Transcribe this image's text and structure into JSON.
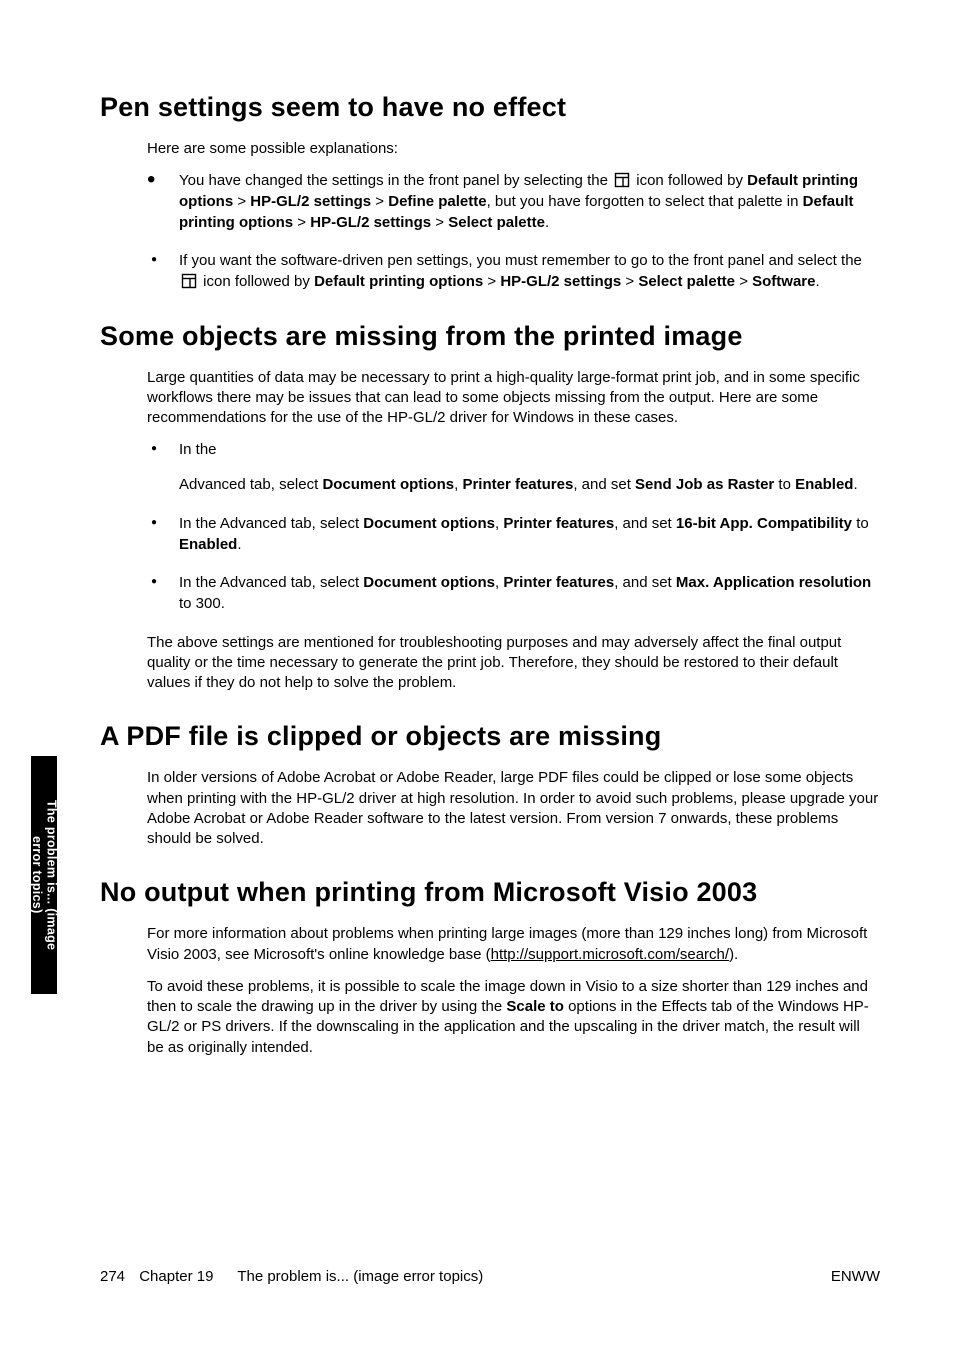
{
  "sections": {
    "pen": {
      "heading": "Pen settings seem to have no effect",
      "intro": "Here are some possible explanations:",
      "bullets": [
        {
          "pre": "You have changed the settings in the front panel by selecting the ",
          "post1": " icon followed by ",
          "b1": "Default printing options",
          "gt1": " > ",
          "b2": "HP-GL/2 settings",
          "gt2": " > ",
          "b3": "Define palette",
          "mid": ", but you have forgotten to select that palette in ",
          "b4": "Default printing options",
          "gt3": " > ",
          "b5": "HP-GL/2 settings",
          "gt4": " > ",
          "b6": "Select palette",
          "end": "."
        },
        {
          "pre": "If you want the software-driven pen settings, you must remember to go to the front panel and select the ",
          "post1": " icon followed by ",
          "b1": "Default printing options",
          "gt1": " > ",
          "b2": "HP-GL/2 settings",
          "gt2": " > ",
          "b3": "Select palette",
          "gt3": " > ",
          "b4": "Software",
          "end": "."
        }
      ]
    },
    "missing": {
      "heading": "Some objects are missing from the printed image",
      "intro": "Large quantities of data may be necessary to print a high-quality large-format print job, and in some specific workflows there may be issues that can lead to some objects missing from the output. Here are some recommendations for the use of the HP-GL/2 driver for Windows in these cases.",
      "bullets": [
        {
          "line1": "In the",
          "line2_pre": "Advanced tab, select ",
          "b1": "Document options",
          "sep1": ", ",
          "b2": "Printer features",
          "mid": ", and set ",
          "b3": "Send Job as Raster",
          "to": " to ",
          "b4": "Enabled",
          "end": "."
        },
        {
          "pre": "In the Advanced tab, select ",
          "b1": "Document options",
          "sep1": ", ",
          "b2": "Printer features",
          "mid": ", and set ",
          "b3": "16-bit App. Compatibility",
          "to": " to ",
          "b4": "Enabled",
          "end": "."
        },
        {
          "pre": "In the Advanced tab, select ",
          "b1": "Document options",
          "sep1": ", ",
          "b2": "Printer features",
          "mid": ", and set ",
          "b3": "Max. Application resolution",
          "to": " to 300.",
          "end": ""
        }
      ],
      "outro": "The above settings are mentioned for troubleshooting purposes and may adversely affect the final output quality or the time necessary to generate the print job. Therefore, they should be restored to their default values if they do not help to solve the problem."
    },
    "pdf": {
      "heading": "A PDF file is clipped or objects are missing",
      "body": "In older versions of Adobe Acrobat or Adobe Reader, large PDF files could be clipped or lose some objects when printing with the HP-GL/2 driver at high resolution. In order to avoid such problems, please upgrade your Adobe Acrobat or Adobe Reader software to the latest version. From version 7 onwards, these problems should be solved."
    },
    "visio": {
      "heading": "No output when printing from Microsoft Visio 2003",
      "p1_pre": "For more information about problems when printing large images (more than 129 inches long) from Microsoft Visio 2003, see Microsoft's online knowledge base (",
      "p1_link": "http://support.microsoft.com/search/",
      "p1_post": ").",
      "p2_pre": "To avoid these problems, it is possible to scale the image down in Visio to a size shorter than 129 inches and then to scale the drawing up in the driver by using the ",
      "p2_bold": "Scale to",
      "p2_post": " options in the Effects tab of the Windows HP-GL/2 or PS drivers. If the downscaling in the application and the upscaling in the driver match, the result will be as originally intended."
    }
  },
  "sideTab": {
    "line1": "The problem is... (image",
    "line2": "error topics)"
  },
  "footer": {
    "pageNum": "274",
    "chapter": "Chapter 19",
    "title": "The problem is... (image error topics)",
    "right": "ENWW"
  }
}
